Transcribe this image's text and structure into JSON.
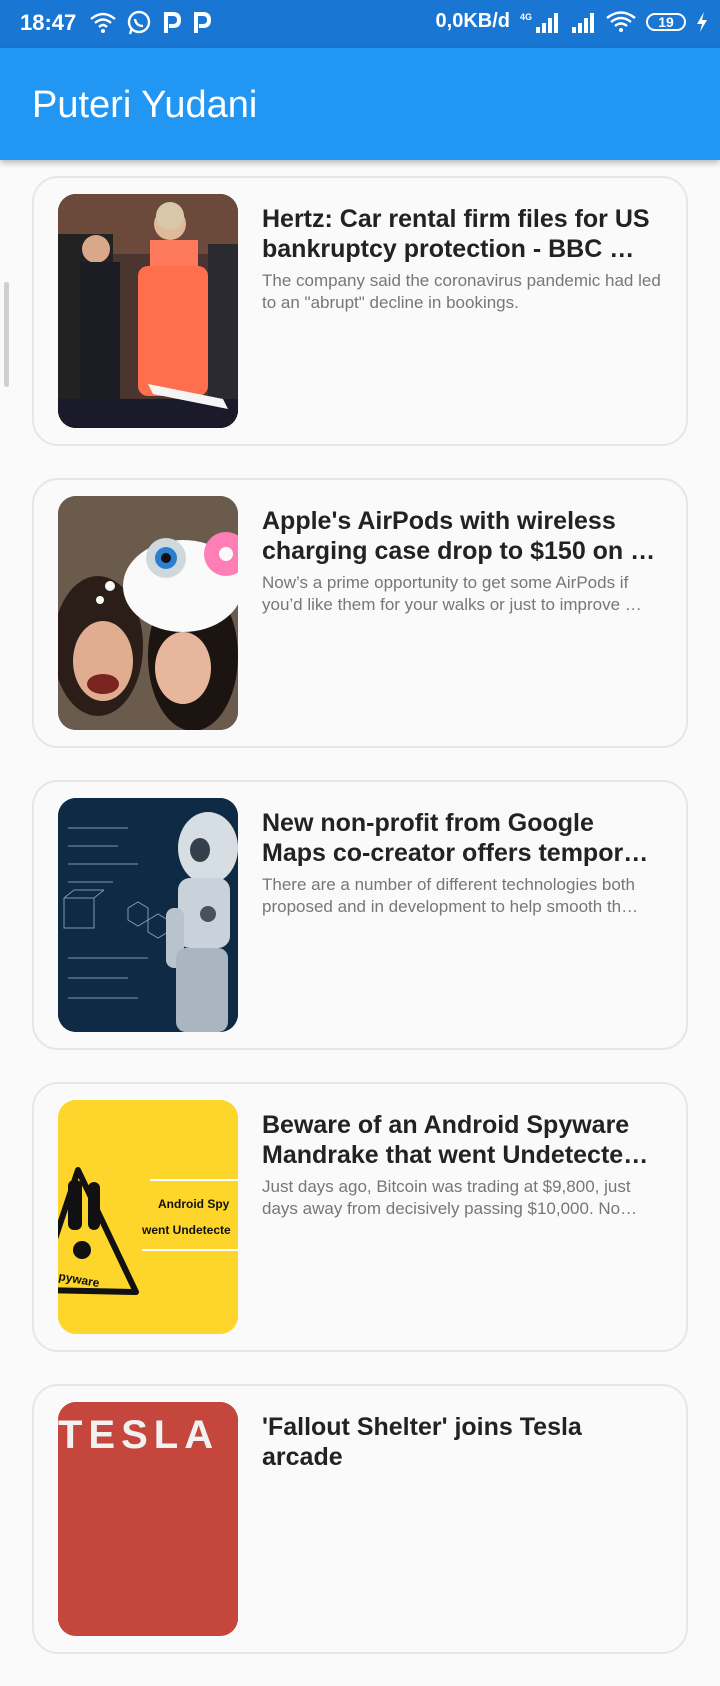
{
  "status_bar": {
    "time": "18:47",
    "icons_left": [
      "wifi-icon",
      "whatsapp-icon",
      "p-app-icon",
      "p-app-icon"
    ],
    "speed": "0,0KB/d",
    "network": "4G",
    "battery": "19"
  },
  "app_bar": {
    "title": "Puteri Yudani"
  },
  "articles": [
    {
      "title": "Hertz: Car rental firm files for US bankruptcy protection - BBC …",
      "description": "The company said the coronavirus pandemic had led to an \"abrupt\" decline in bookings."
    },
    {
      "title": "Apple's AirPods with wireless charging case drop to $150 on …",
      "description": "Now’s a prime opportunity to get some AirPods if you’d like them for your walks or just to improve …"
    },
    {
      "title": "New non-profit from Google Maps co-creator offers temporary ‘saf…",
      "description": "There are a number of different technologies both proposed and in development to help smooth th…"
    },
    {
      "title": "Beware of an Android Spyware Mandrake that went Undetected …",
      "description": "Just days ago, Bitcoin was trading at $9,800, just days away from decisively passing $10,000. No…",
      "thumb_text": [
        "Android Spy",
        "went Undetecte",
        "pyware"
      ]
    },
    {
      "title": "'Fallout Shelter' joins Tesla arcade",
      "description": "",
      "thumb_text": [
        "TESLA"
      ]
    }
  ]
}
